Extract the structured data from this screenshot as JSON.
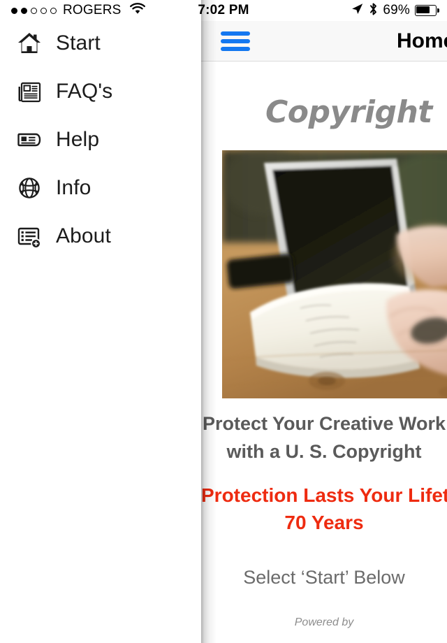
{
  "status_bar": {
    "signal_dots_filled": 2,
    "signal_dots_total": 5,
    "carrier": "ROGERS",
    "wifi_icon": "wifi-icon",
    "time": "7:02 PM",
    "location_icon": "location-arrow-icon",
    "bluetooth_icon": "bluetooth-icon",
    "battery_percent": "69%",
    "battery_level": 69
  },
  "drawer": {
    "items": [
      {
        "label": "Start",
        "icon": "home-icon"
      },
      {
        "label": "FAQ's",
        "icon": "newspaper-icon"
      },
      {
        "label": "Help",
        "icon": "id-card-icon"
      },
      {
        "label": "Info",
        "icon": "globe-icon"
      },
      {
        "label": "About",
        "icon": "list-add-icon"
      }
    ]
  },
  "navbar": {
    "menu_icon": "hamburger-menu-icon",
    "title": "Home",
    "menu_icon_color": "#1478f0"
  },
  "page": {
    "logo_text": "Copyright",
    "hero_image_alt": "hands-writing-in-notebook-beside-laptop-photo",
    "heading_line1": "Protect Your Creative Work",
    "heading_line2": "with a U. S. Copyright",
    "red_line1": "Protection Lasts Your Lifetime +",
    "red_line2": "70 Years",
    "select_text": "Select ‘Start’ Below",
    "footer_text": "Powered by",
    "heading_color": "#5a5a5a",
    "red_color": "#ee2b10",
    "logo_color": "#8a8a8a"
  }
}
